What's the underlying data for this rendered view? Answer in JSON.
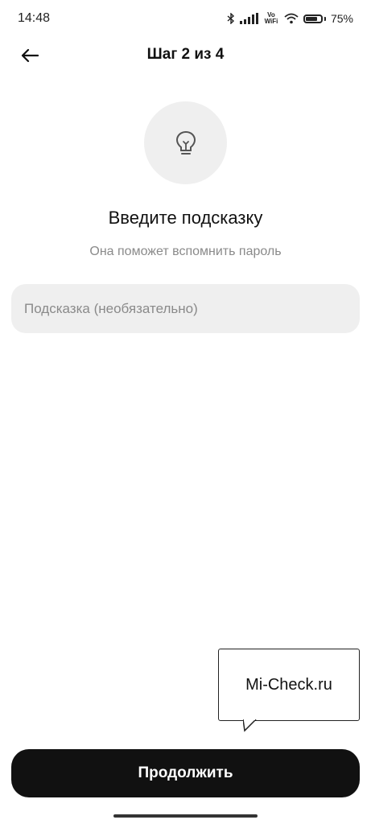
{
  "status_bar": {
    "time": "14:48",
    "network_label": "Vo WiFi",
    "battery": "75%"
  },
  "header": {
    "title": "Шаг 2 из 4",
    "back_icon": "arrow-left-icon"
  },
  "main": {
    "icon": "lightbulb-icon",
    "heading": "Введите подсказку",
    "subheading": "Она поможет вспомнить пароль",
    "hint_placeholder": "Подсказка (необязательно)",
    "hint_value": ""
  },
  "watermark": {
    "text": "Mi-Check.ru"
  },
  "footer": {
    "continue_label": "Продолжить"
  },
  "colors": {
    "primary_button": "#111111",
    "field_background": "#efefef",
    "secondary_text": "#8a8a8a"
  }
}
